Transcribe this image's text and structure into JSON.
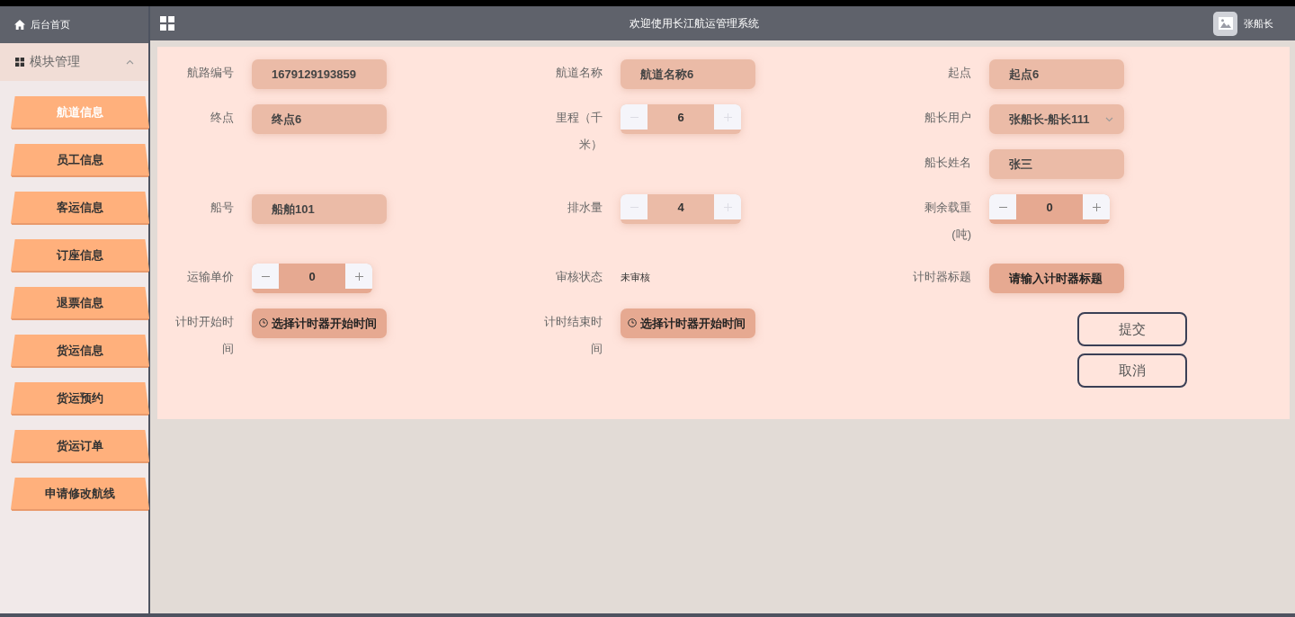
{
  "sidebar": {
    "home": "后台首页",
    "group": {
      "label": "模块管理",
      "expanded": true
    },
    "items": [
      {
        "label": "航道信息",
        "selected": true
      },
      {
        "label": "员工信息",
        "selected": false
      },
      {
        "label": "客运信息",
        "selected": false
      },
      {
        "label": "订座信息",
        "selected": false
      },
      {
        "label": "退票信息",
        "selected": false
      },
      {
        "label": "货运信息",
        "selected": false
      },
      {
        "label": "货运预约",
        "selected": false
      },
      {
        "label": "货运订单",
        "selected": false
      },
      {
        "label": "申请修改航线",
        "selected": false
      }
    ]
  },
  "header": {
    "title": "欢迎使用长江航运管理系统",
    "user": "张船长"
  },
  "form": {
    "rows": [
      [
        {
          "fields": [
            {
              "kind": "text",
              "label": "航路编号",
              "value": "1679129193859"
            }
          ]
        },
        {
          "fields": [
            {
              "kind": "text",
              "label": "航道名称",
              "value": "航道名称6"
            }
          ]
        },
        {
          "fields": [
            {
              "kind": "text",
              "label": "起点",
              "value": "起点6"
            }
          ]
        }
      ],
      [
        {
          "fields": [
            {
              "kind": "text",
              "label": "终点",
              "value": "终点6"
            }
          ]
        },
        {
          "fields": [
            {
              "kind": "stepper",
              "label": "里程（千米）",
              "value": "6",
              "disabled": true
            }
          ]
        },
        {
          "fields": [
            {
              "kind": "select",
              "label": "船长用户",
              "value": "张船长-船长111"
            },
            {
              "kind": "text",
              "label": "船长姓名",
              "value": "张三"
            }
          ]
        }
      ],
      [
        {
          "fields": [
            {
              "kind": "text",
              "label": "船号",
              "value": "船舶101"
            }
          ]
        },
        {
          "fields": [
            {
              "kind": "stepper",
              "label": "排水量",
              "value": "4",
              "disabled": true
            }
          ]
        },
        {
          "fields": [
            {
              "kind": "stepper",
              "label": "剩余载重(吨)",
              "value": "0",
              "disabled": false
            }
          ]
        }
      ],
      [
        {
          "fields": [
            {
              "kind": "stepper",
              "label": "运输单价",
              "value": "0",
              "disabled": false
            }
          ]
        },
        {
          "fields": [
            {
              "kind": "status",
              "label": "审核状态",
              "value": "未审核"
            }
          ]
        },
        {
          "fields": [
            {
              "kind": "input",
              "label": "计时器标题",
              "placeholder": "请输入计时器标题"
            }
          ]
        }
      ],
      [
        {
          "fields": [
            {
              "kind": "date",
              "label": "计时开始时间",
              "placeholder": "选择计时器开始时间"
            }
          ]
        },
        {
          "fields": [
            {
              "kind": "date",
              "label": "计时结束时间",
              "placeholder": "选择计时器开始时间"
            }
          ]
        },
        {
          "buttons": [
            "提交",
            "取消"
          ]
        }
      ]
    ]
  }
}
